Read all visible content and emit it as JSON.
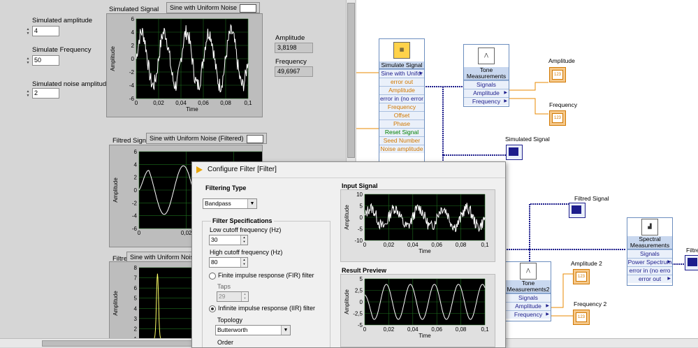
{
  "front_panel": {
    "controls": [
      {
        "label": "Simulated amplitude",
        "value": "4"
      },
      {
        "label": "Simulate Frequency",
        "value": "50"
      },
      {
        "label": "Simulated noise amplitude",
        "value": "2"
      }
    ],
    "indicators": [
      {
        "label": "Amplitude",
        "value": "3,8198"
      },
      {
        "label": "Frequency",
        "value": "49,6967"
      }
    ],
    "graphs": [
      {
        "label": "Simulated Signal",
        "legend": "Sine with Uniform Noise",
        "ylabel": "Amplitude",
        "xlabel": "Time",
        "yticks": [
          "6",
          "4",
          "2",
          "0",
          "-2",
          "-4",
          "-6"
        ],
        "xticks": [
          "0",
          "0,02",
          "0,04",
          "0,06",
          "0,08",
          "0,1"
        ]
      },
      {
        "label": "Filtred Signal",
        "legend": "Sine with Uniform Noise (Filtered)",
        "ylabel": "Amplitude",
        "yticks": [
          "6",
          "4",
          "2",
          "0",
          "-2",
          "-4",
          "-6"
        ],
        "xticks": [
          "0",
          "0,02",
          "0,04"
        ]
      },
      {
        "label": "Filtred Signal 2",
        "legend": "Sine with Uniform Noise",
        "ylabel": "Amplitude",
        "yticks": [
          "8",
          "7",
          "6",
          "5",
          "4",
          "3",
          "2",
          "1"
        ]
      }
    ]
  },
  "block_diagram": {
    "simulate_signal": {
      "title": "Simulate Signal",
      "terminals": [
        "Sine with Unifor",
        "error out",
        "Amplitude",
        "error in (no error",
        "Frequency",
        "Offset",
        "Phase",
        "Reset Signal",
        "Seed Number",
        "Noise amplitude"
      ]
    },
    "tone_measurements": {
      "title": "Tone Measurements",
      "terminals": [
        "Signals",
        "Amplitude",
        "Frequency"
      ]
    },
    "tone_measurements2": {
      "title": "Tone Measurements2",
      "terminals": [
        "Signals",
        "Amplitude",
        "Frequency"
      ]
    },
    "spectral_measurements": {
      "title": "Spectral Measurements",
      "terminals": [
        "Signals",
        "Power Spectrum",
        "error in (no erro",
        "error out"
      ]
    },
    "labels": {
      "amplitude": "Amplitude",
      "frequency": "Frequency",
      "simulated_signal": "Simulated Signal",
      "filtred_signal": "Filtred Signal",
      "amplitude2": "Amplitude 2",
      "frequency2": "Frequency 2",
      "filtre_cut": "Filtre",
      "num_icon": "123"
    }
  },
  "dialog": {
    "title": "Configure Filter [Filter]",
    "filtering_type_label": "Filtering Type",
    "filtering_type_value": "Bandpass",
    "filter_specs_label": "Filter Specifications",
    "low_cutoff_label": "Low cutoff frequency (Hz)",
    "low_cutoff_value": "30",
    "high_cutoff_label": "High cutoff frequency (Hz)",
    "high_cutoff_value": "80",
    "fir_label": "Finite impulse response (FIR) filter",
    "taps_label": "Taps",
    "taps_value": "29",
    "iir_label": "Infinite impulse response (IIR) filter",
    "topology_label": "Topology",
    "topology_value": "Butterworth",
    "order_label": "Order",
    "input_signal_label": "Input Signal",
    "input_yticks": [
      "10",
      "5",
      "0",
      "-5",
      "-10"
    ],
    "result_preview_label": "Result Preview",
    "result_yticks": [
      "5",
      "2,5",
      "0",
      "-2,5",
      "-5"
    ],
    "xticks": [
      "0",
      "0,02",
      "0,04",
      "0,06",
      "0,08",
      "0,1"
    ],
    "xlabel": "Time",
    "ylabel": "Amplitude",
    "selected_filter": "iir"
  },
  "colors": {
    "plot_bg": "#000000",
    "grid": "#1e6e1e",
    "trace": "#ffffff",
    "trace_yellow": "#ffff66",
    "wire_blue": "#1d1d8c",
    "wire_orange": "#e88a00"
  }
}
